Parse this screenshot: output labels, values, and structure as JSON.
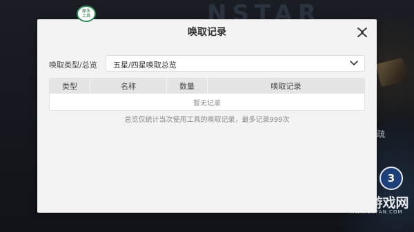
{
  "background": {
    "heading_glyphs": "NSTAR",
    "side_text": "疏",
    "watermark": {
      "badge": "3",
      "title": "不凡游戏网",
      "url": "WWW.BUFAN.COM"
    }
  },
  "helper_badge": {
    "line1": "原多",
    "line2": "工具"
  },
  "modal": {
    "title": "唤取记录",
    "close_icon": "close-x-icon",
    "filter": {
      "label": "唤取类型/总览",
      "selected": "五星/四星唤取总览",
      "chevron_icon": "chevron-down-icon"
    },
    "table": {
      "columns": [
        "类型",
        "名称",
        "数量",
        "唤取记录"
      ],
      "empty_text": "暂无记录"
    },
    "footnote": "总览仅统计当次使用工具的唤取记录，最多记录999次"
  },
  "colors": {
    "modal_bg": "#f3f3f3",
    "header_bg": "#e4e4e4",
    "badge_green": "#2e8b57",
    "watermark_blue": "#1d3f7a"
  }
}
